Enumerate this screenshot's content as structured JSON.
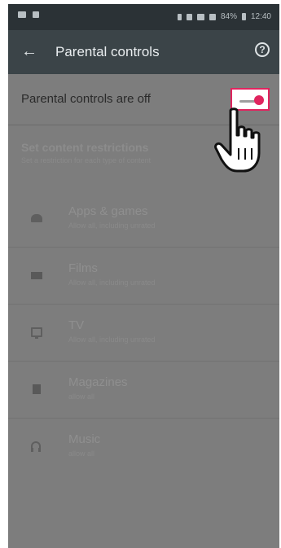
{
  "status_bar": {
    "battery": "84%",
    "time": "12:40"
  },
  "app_bar": {
    "back_icon": "arrow-back-icon",
    "title": "Parental controls",
    "help_icon": "help-icon"
  },
  "main_toggle": {
    "label": "Parental controls are off",
    "state": "off",
    "highlight_color": "#e0245e"
  },
  "restrictions": {
    "title": "Set content restrictions",
    "subtitle": "Set a restriction for each type of content"
  },
  "categories": [
    {
      "name": "Apps & games",
      "desc": "Allow all, including unrated",
      "icon": "android-icon"
    },
    {
      "name": "Films",
      "desc": "Allow all, including unrated",
      "icon": "film-icon"
    },
    {
      "name": "TV",
      "desc": "Allow all, including unrated",
      "icon": "tv-icon"
    },
    {
      "name": "Magazines",
      "desc": "allow all",
      "icon": "magazine-icon"
    },
    {
      "name": "Music",
      "desc": "allow all",
      "icon": "headphones-icon"
    }
  ]
}
